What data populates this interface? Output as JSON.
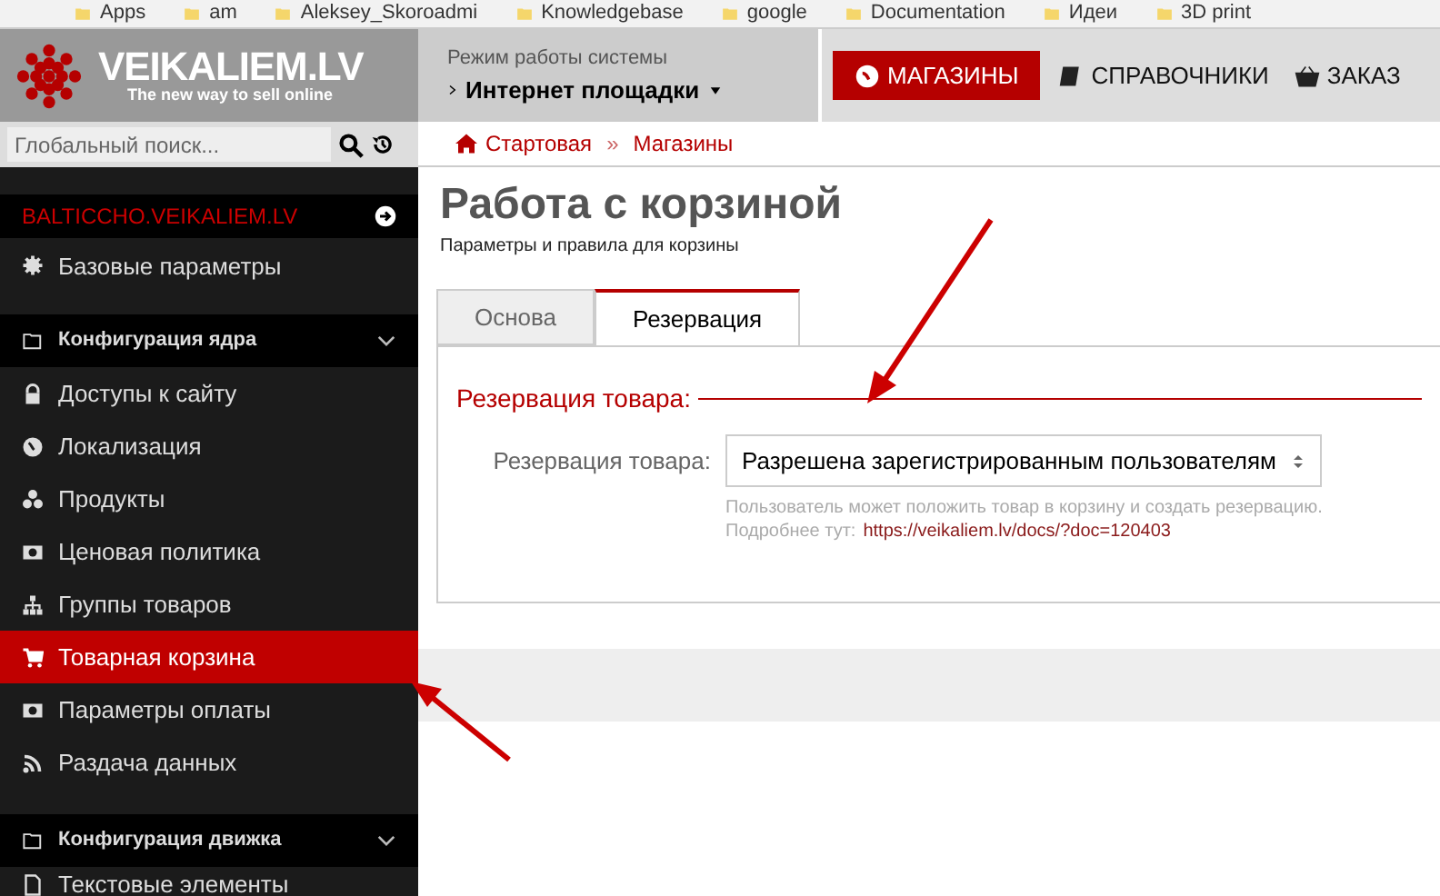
{
  "bookmarks": [
    "Apps",
    "am",
    "Aleksey_Skoroadmi",
    "Knowledgebase",
    "google",
    "Documentation",
    "Идеи",
    "3D print"
  ],
  "logo": {
    "name": "VEIKALIEM.LV",
    "tagline": "The new way to sell online"
  },
  "mode": {
    "label": "Режим работы системы",
    "value": "Интернет площадки"
  },
  "nav": [
    {
      "label": "МАГАЗИНЫ",
      "selected": true
    },
    {
      "label": "СПРАВОЧНИКИ",
      "selected": false
    },
    {
      "label": "ЗАКАЗ",
      "selected": false
    }
  ],
  "search": {
    "placeholder": "Глобальный поиск..."
  },
  "breadcrumbs": [
    "Стартовая",
    "»",
    "Магазины"
  ],
  "sidebar": {
    "site": "BALTICCHO.VEIKALIEM.LV",
    "items": [
      {
        "kind": "item",
        "label": "Базовые параметры",
        "selected": false
      },
      {
        "kind": "section",
        "label": "Конфигурация ядра",
        "expanded": true
      },
      {
        "kind": "item",
        "label": "Доступы к сайту",
        "selected": false
      },
      {
        "kind": "item",
        "label": "Локализация",
        "selected": false
      },
      {
        "kind": "item",
        "label": "Продукты",
        "selected": false
      },
      {
        "kind": "item",
        "label": "Ценовая политика",
        "selected": false
      },
      {
        "kind": "item",
        "label": "Группы товаров",
        "selected": false
      },
      {
        "kind": "item",
        "label": "Товарная корзина",
        "selected": true
      },
      {
        "kind": "item",
        "label": "Параметры оплаты",
        "selected": false
      },
      {
        "kind": "item",
        "label": "Раздача данных",
        "selected": false
      },
      {
        "kind": "section",
        "label": "Конфигурация движка",
        "expanded": true
      },
      {
        "kind": "item",
        "label": "Текстовые элементы",
        "selected": false
      }
    ]
  },
  "page": {
    "title": "Работа с корзиной",
    "subtitle": "Параметры и правила для корзины"
  },
  "tabs": [
    {
      "label": "Основа",
      "selected": false
    },
    {
      "label": "Резервация",
      "selected": true
    }
  ],
  "fieldset": {
    "legend": "Резервация товара:",
    "label": "Резервация товара:",
    "value": "Разрешена зарегистрированным пользователям",
    "help": "Пользователь может положить товар в корзину и создать резервацию.",
    "more_label": "Подробнее тут:",
    "link": "https://veikaliem.lv/docs/?doc=120403"
  }
}
